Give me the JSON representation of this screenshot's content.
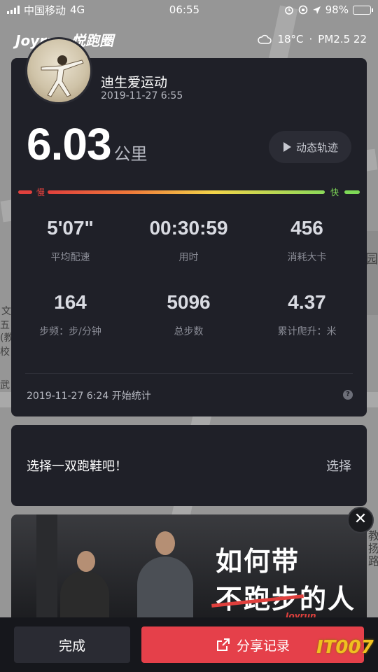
{
  "status_bar": {
    "carrier": "中国移动",
    "network": "4G",
    "time": "06:55",
    "battery": "98%",
    "battery_level": 0.98
  },
  "header": {
    "logo": "Joyrun·悦跑圈",
    "temperature": "18°C",
    "separator": "·",
    "air_quality": "PM2.5 22"
  },
  "map_labels": [
    "园",
    "文",
    "五",
    "(教",
    "校",
    "武",
    "教",
    "扬",
    "路"
  ],
  "user": {
    "name": "迪生爱运动",
    "datetime": "2019-11-27 6:55"
  },
  "run": {
    "distance": "6.03",
    "distance_unit": "公里",
    "track_button": "动态轨迹",
    "slow_label": "慢",
    "fast_label": "快"
  },
  "stats": [
    {
      "value": "5'07\"",
      "label": "平均配速"
    },
    {
      "value": "00:30:59",
      "label": "用时"
    },
    {
      "value": "456",
      "label": "消耗大卡"
    },
    {
      "value": "164",
      "label": "步频：步/分钟"
    },
    {
      "value": "5096",
      "label": "总步数"
    },
    {
      "value": "4.37",
      "label": "累计爬升：米"
    }
  ],
  "start_info": "2019-11-27 6:24 开始统计",
  "help_icon": "?",
  "shoe": {
    "prompt": "选择一双跑鞋吧！",
    "action": "选择"
  },
  "ad": {
    "line1": "如何带",
    "line2_struck": "不跑步",
    "line2_rest": "的人",
    "brand": "Joyrun",
    "close": "✕"
  },
  "bottom": {
    "done": "完成",
    "share": "分享记录"
  },
  "watermark": "IT007"
}
